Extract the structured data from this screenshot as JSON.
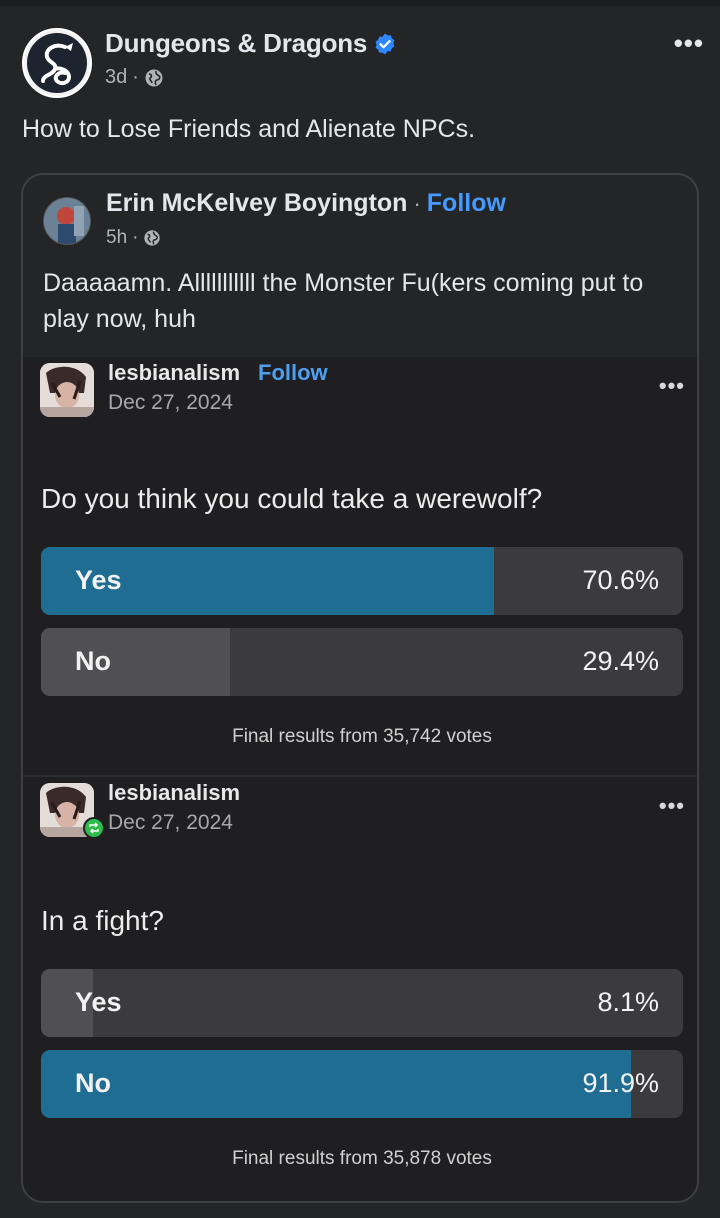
{
  "post": {
    "page_name": "Dungeons & Dragons",
    "verified": true,
    "time": "3d",
    "audience_icon": "globe-icon",
    "more_icon": "•••",
    "caption": "How to Lose Friends and Alienate NPCs."
  },
  "shared": {
    "author": "Erin McKelvey Boyington",
    "separator": "·",
    "follow_label": "Follow",
    "time": "5h",
    "text": "Daaaaamn. Alllllllllll the Monster Fu(kers coming put to play now, huh"
  },
  "polls": [
    {
      "username": "lesbianalism",
      "follow_label": "Follow",
      "date": "Dec 27, 2024",
      "more_icon": "•••",
      "question": "Do you think you could take a werewolf?",
      "options": [
        {
          "label": "Yes",
          "percent": "70.6%",
          "fraction": 0.706,
          "winner": true
        },
        {
          "label": "No",
          "percent": "29.4%",
          "fraction": 0.294,
          "winner": false
        }
      ],
      "footer": "Final results from 35,742 votes"
    },
    {
      "username": "lesbianalism",
      "date": "Dec 27, 2024",
      "more_icon": "•••",
      "reblogged": true,
      "question": "In a fight?",
      "options": [
        {
          "label": "Yes",
          "percent": "8.1%",
          "fraction": 0.081,
          "winner": false
        },
        {
          "label": "No",
          "percent": "91.9%",
          "fraction": 0.919,
          "winner": true
        }
      ],
      "footer": "Final results from 35,878 votes"
    }
  ],
  "colors": {
    "background": "#242526",
    "link_blue": "#4599ff",
    "poll_winner": "#1f6d92",
    "poll_loser": "#505053",
    "verified_blue": "#2d88ff",
    "reblog_green": "#2dbd4a"
  }
}
